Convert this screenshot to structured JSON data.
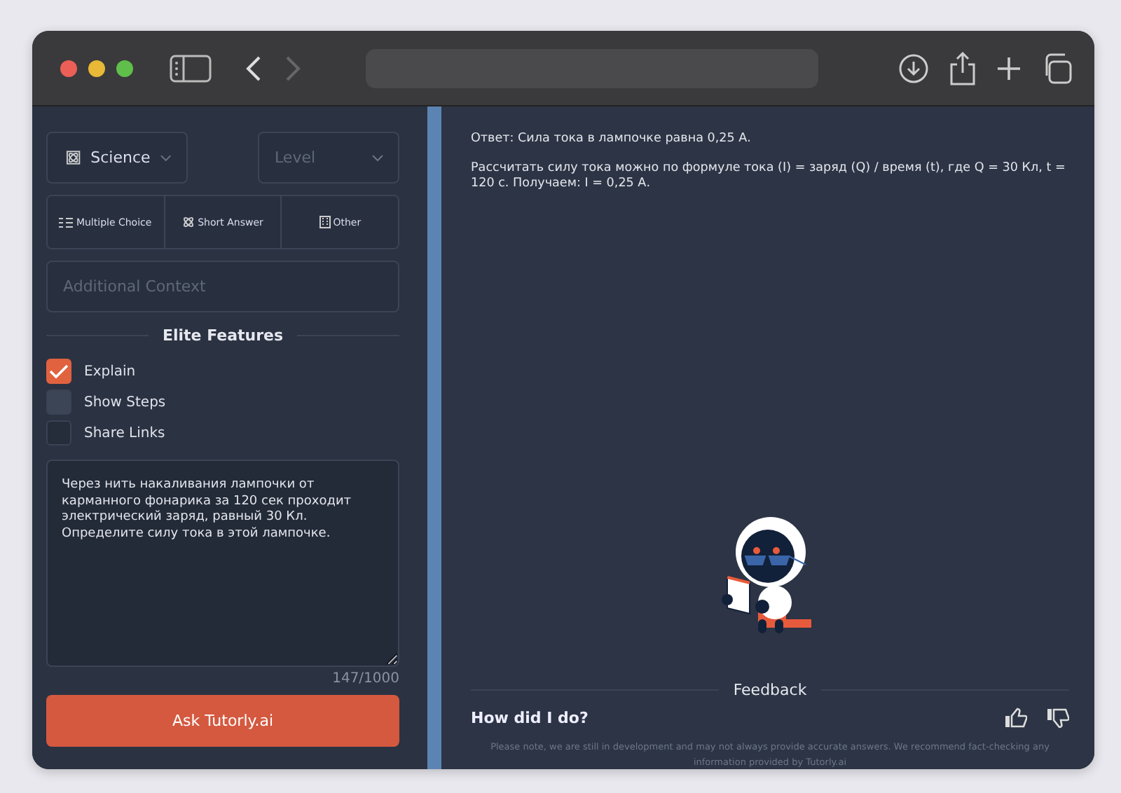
{
  "sidebar": {
    "subject": {
      "label": "Science"
    },
    "level": {
      "placeholder": "Level"
    },
    "question_types": [
      {
        "label": "Multiple Choice"
      },
      {
        "label": "Short Answer"
      },
      {
        "label": "Other"
      }
    ],
    "context": {
      "placeholder": "Additional Context"
    },
    "features_title": "Elite Features",
    "features": [
      {
        "label": "Explain",
        "checked": true
      },
      {
        "label": "Show Steps",
        "checked": false
      },
      {
        "label": "Share Links",
        "checked": false
      }
    ],
    "question": {
      "value": "Через нить накаливания лампочки от карманного фонарика за 120 сек проходит электрический заряд, равный 30 Кл. Определите силу тока в этой лампочке."
    },
    "counter": "147/1000",
    "submit": "Ask Tutorly.ai"
  },
  "answer": {
    "paragraphs": [
      "Ответ: Сила тока в лампочке равна 0,25 А.",
      "Рассчитать силу тока можно по формуле тока (I) = заряд (Q) / время (t), где Q = 30 Кл, t = 120 с. Получаем: I = 0,25 А."
    ]
  },
  "feedback": {
    "title": "Feedback",
    "prompt": "How did I do?",
    "disclaimer": "Please note, we are still in development and may not always provide accurate answers. We recommend fact-checking any information provided by Tutorly.ai"
  }
}
